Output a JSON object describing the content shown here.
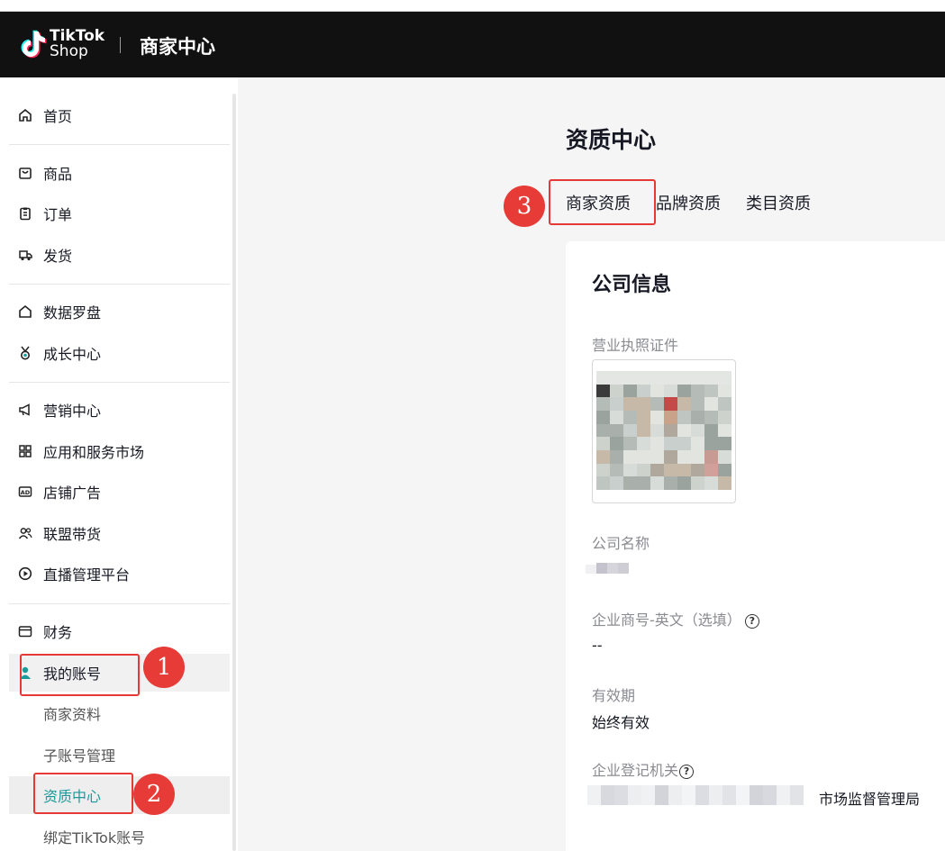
{
  "header": {
    "brand_line1": "TikTok",
    "brand_line2": "Shop",
    "product_title": "商家中心"
  },
  "sidebar": {
    "items": [
      {
        "label": "首页",
        "icon": "home-icon"
      },
      {
        "label": "商品",
        "icon": "bag-icon"
      },
      {
        "label": "订单",
        "icon": "clipboard-icon"
      },
      {
        "label": "发货",
        "icon": "truck-icon"
      },
      {
        "label": "数据罗盘",
        "icon": "compass-icon"
      },
      {
        "label": "成长中心",
        "icon": "medal-icon"
      },
      {
        "label": "营销中心",
        "icon": "megaphone-icon"
      },
      {
        "label": "应用和服务市场",
        "icon": "apps-icon"
      },
      {
        "label": "店铺广告",
        "icon": "ad-icon"
      },
      {
        "label": "联盟带货",
        "icon": "people-icon"
      },
      {
        "label": "直播管理平台",
        "icon": "play-icon"
      },
      {
        "label": "财务",
        "icon": "wallet-icon"
      },
      {
        "label": "我的账号",
        "icon": "user-icon"
      }
    ],
    "sub_items": [
      "商家资料",
      "子账号管理",
      "资质中心",
      "绑定TikTok账号"
    ]
  },
  "main": {
    "page_title": "资质中心",
    "tabs": [
      "商家资质",
      "品牌资质",
      "类目资质"
    ],
    "card": {
      "title": "公司信息",
      "license_label": "营业执照证件",
      "company_name_label": "公司名称",
      "en_name_label": "企业商号-英文（选填）",
      "en_name_value": "--",
      "validity_label": "有效期",
      "validity_value": "始终有效",
      "authority_label": "企业登记机关",
      "authority_value_suffix": "市场监督管理局"
    }
  },
  "annotations": {
    "step1": "1",
    "step2": "2",
    "step3": "3"
  },
  "colors": {
    "header_bg": "#111111",
    "active_text": "#1a9a9a",
    "highlight_red": "#e53935"
  }
}
